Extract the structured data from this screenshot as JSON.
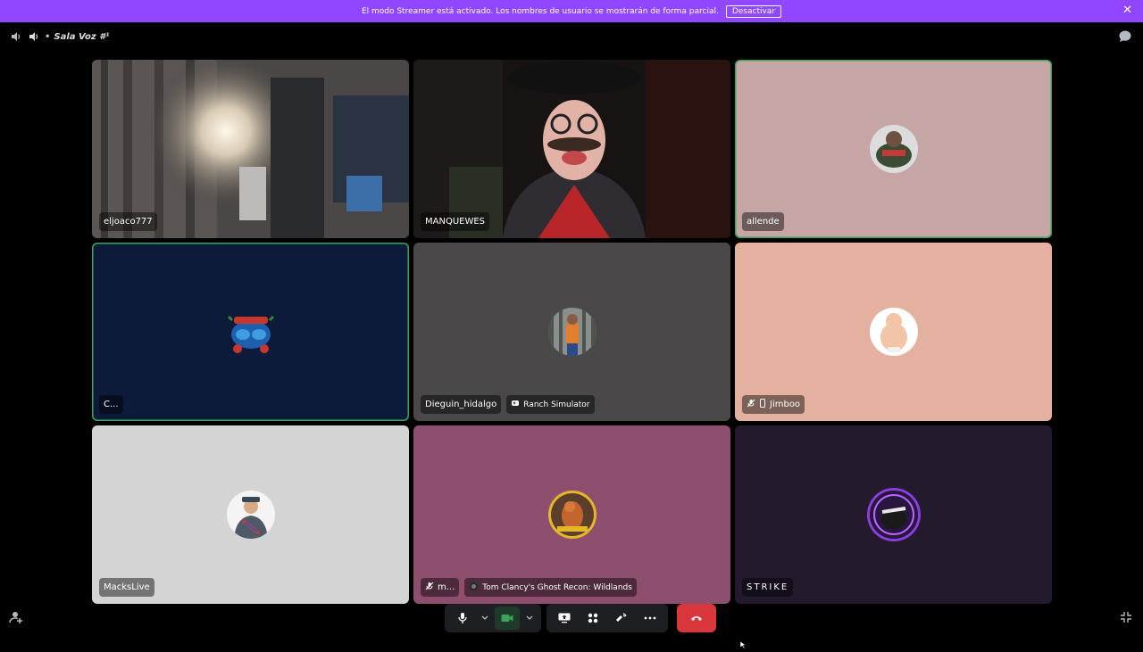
{
  "banner": {
    "message": "El modo Streamer está activado. Los nombres de usuario se mostrarán de forma parcial.",
    "button_label": "Desactivar",
    "close_glyph": "✕",
    "color": "#9146ff"
  },
  "header": {
    "channel_name": "Sala Voz #¹",
    "icons": [
      "speaker-icon",
      "volume-icon",
      "chat-icon"
    ]
  },
  "tiles": [
    {
      "name": "eljoaco777",
      "type": "video",
      "speaking": false
    },
    {
      "name": "MANQUEWES",
      "type": "video",
      "speaking": true
    },
    {
      "name": "allende",
      "type": "avatar",
      "bg": "#c5a6a4",
      "speaking": true
    },
    {
      "name": "C...",
      "type": "avatar",
      "bg": "#0e1a3a",
      "speaking": true
    },
    {
      "name": "Dieguin_hidalgo",
      "activity": "Ranch Simulator",
      "type": "avatar",
      "bg": "#4a4849",
      "speaking": false
    },
    {
      "name": "Jimboo",
      "type": "avatar",
      "bg": "#e4b1a0",
      "speaking": false,
      "icons": [
        "muted-icon",
        "mobile-icon"
      ]
    },
    {
      "name": "MacksLive",
      "type": "avatar",
      "bg": "#d4d4d4",
      "speaking": false
    },
    {
      "name": "m...",
      "activity": "Tom Clancy's Ghost Recon: Wildlands",
      "type": "avatar",
      "bg": "#8e4f6e",
      "speaking": false,
      "icons": [
        "muted-icon"
      ]
    },
    {
      "name": "STRIKE",
      "type": "avatar",
      "bg": "#241a2e",
      "speaking": false
    }
  ],
  "controls": {
    "icons": [
      "microphone-icon",
      "chevron-down-icon",
      "camera-icon",
      "chevron-down-icon",
      "screen-share-icon",
      "activities-icon",
      "soundboard-icon",
      "more-icon",
      "hangup-icon"
    ],
    "hangup_color": "#da373c"
  },
  "corner_icons": [
    "add-user-icon",
    "fullscreen-exit-icon"
  ]
}
